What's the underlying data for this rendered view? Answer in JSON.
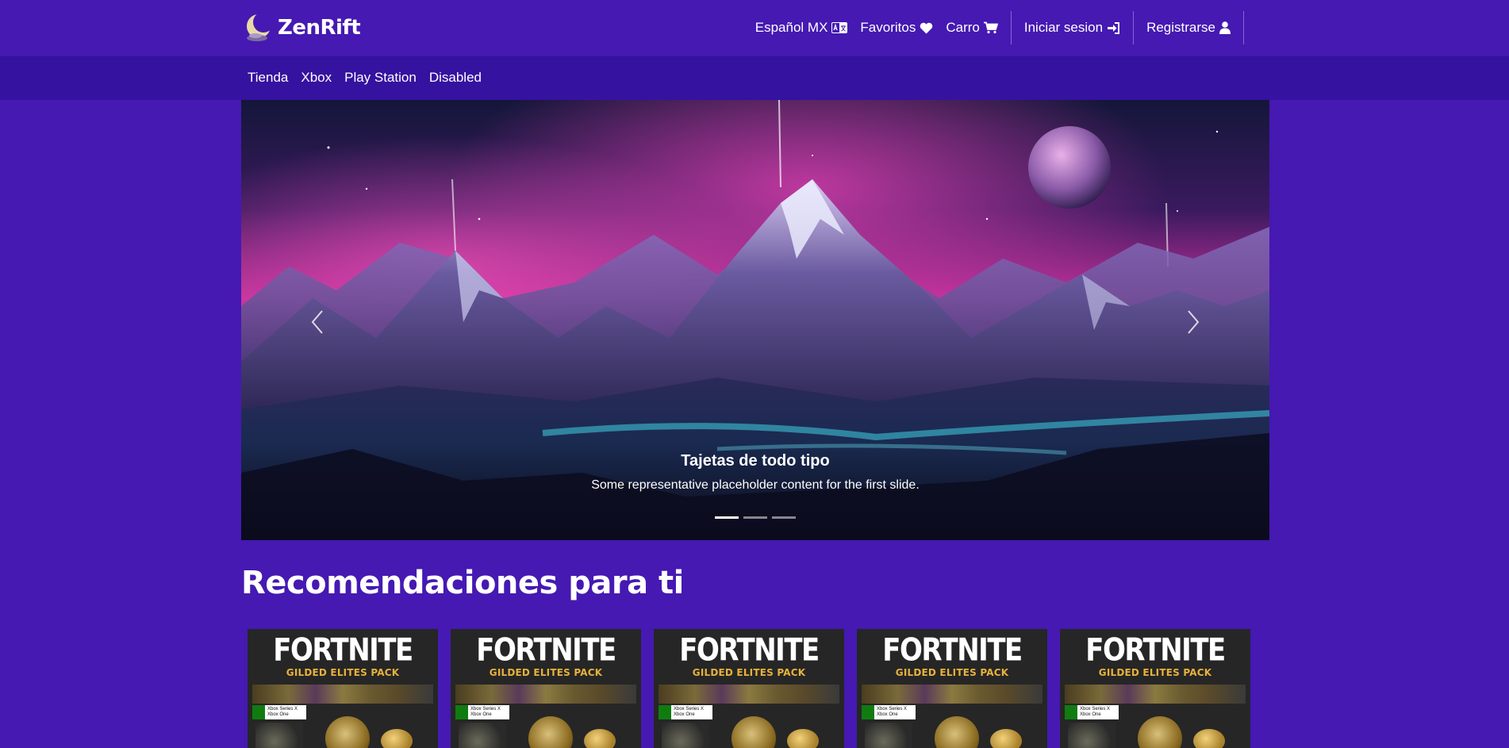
{
  "brand": {
    "name": "ZenRift"
  },
  "topnav": {
    "language": "Español MX",
    "favorites": "Favoritos",
    "cart": "Carro",
    "login": "Iniciar sesion",
    "register": "Registrarse"
  },
  "subnav": {
    "items": [
      {
        "label": "Tienda"
      },
      {
        "label": "Xbox"
      },
      {
        "label": "Play Station"
      },
      {
        "label": "Disabled"
      }
    ]
  },
  "carousel": {
    "caption_title": "Tajetas de todo tipo",
    "caption_text": "Some representative placeholder content for the first slide.",
    "slide_count": 3,
    "active_slide": 1
  },
  "recommendations": {
    "title": "Recomendaciones para ti",
    "cards": [
      {
        "logo": "FORTNITE",
        "subtitle": "GILDED ELITES PACK",
        "platform": "Xbox Series X\nXbox One"
      },
      {
        "logo": "FORTNITE",
        "subtitle": "GILDED ELITES PACK",
        "platform": "Xbox Series X\nXbox One"
      },
      {
        "logo": "FORTNITE",
        "subtitle": "GILDED ELITES PACK",
        "platform": "Xbox Series X\nXbox One"
      },
      {
        "logo": "FORTNITE",
        "subtitle": "GILDED ELITES PACK",
        "platform": "Xbox Series X\nXbox One"
      },
      {
        "logo": "FORTNITE",
        "subtitle": "GILDED ELITES PACK",
        "platform": "Xbox Series X\nXbox One"
      }
    ]
  },
  "colors": {
    "background": "#4519b2",
    "subnav_background": "#3512a0",
    "text": "#ffffff"
  }
}
